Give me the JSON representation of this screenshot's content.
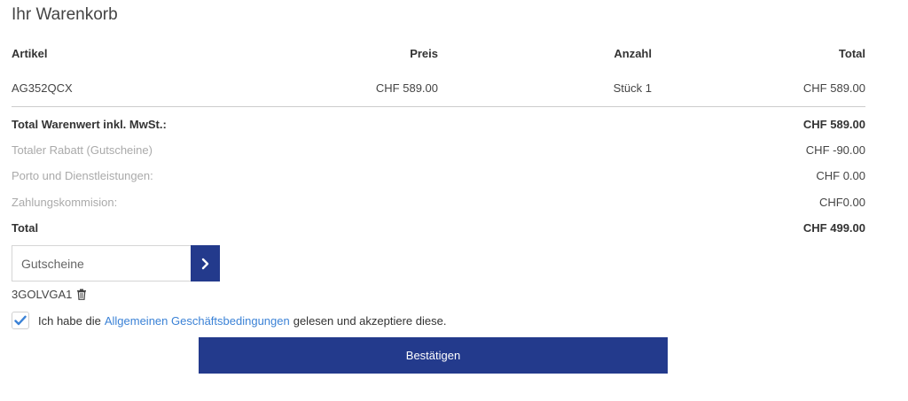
{
  "cart": {
    "title": "Ihr Warenkorb",
    "columns": {
      "article": "Artikel",
      "price": "Preis",
      "quantity": "Anzahl",
      "total": "Total"
    },
    "items": [
      {
        "article": "AG352QCX",
        "price": "CHF 589.00",
        "quantity": "Stück 1",
        "total": "CHF 589.00"
      }
    ]
  },
  "summary": {
    "goods_total_label": "Total Warenwert inkl. MwSt.:",
    "goods_total_value": "CHF 589.00",
    "discount_label": "Totaler Rabatt (Gutscheine)",
    "discount_value": "CHF -90.00",
    "shipping_label": "Porto und Dienstleistungen:",
    "shipping_value": "CHF 0.00",
    "payment_fee_label": "Zahlungskommision:",
    "payment_fee_value": "CHF0.00",
    "total_label": "Total",
    "total_value": "CHF 499.00"
  },
  "voucher": {
    "placeholder": "Gutscheine",
    "applied_code": "3GOLVGA1",
    "submit_icon": "chevron-right-icon",
    "remove_icon": "trash-icon"
  },
  "terms": {
    "checked": true,
    "prefix": "Ich habe die",
    "link_text": "Allgemeinen Geschäftsbedingungen",
    "suffix": "gelesen und akzeptiere diese."
  },
  "actions": {
    "confirm_label": "Bestätigen"
  },
  "colors": {
    "primary": "#233a8c",
    "link": "#3b82d6",
    "muted_text": "#aaaaaa",
    "divider": "#cccccc"
  }
}
